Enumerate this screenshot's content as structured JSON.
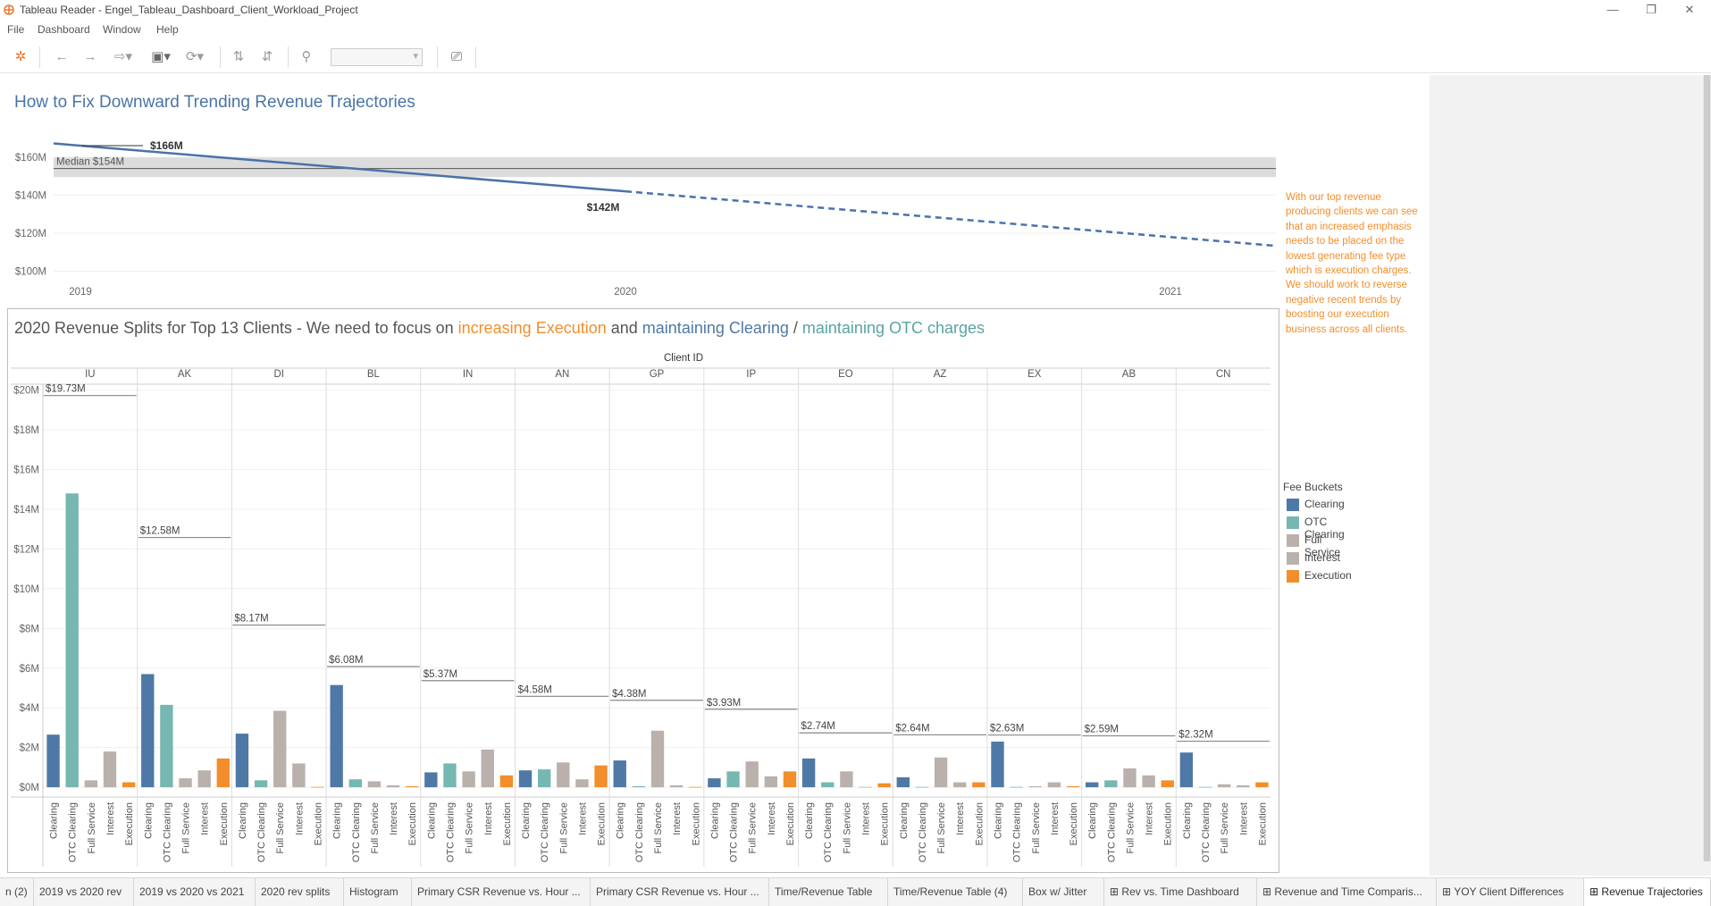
{
  "window": {
    "title": "Tableau Reader - Engel_Tableau_Dashboard_Client_Workload_Project",
    "minimize": "—",
    "restore": "❐",
    "close": "✕"
  },
  "menu": [
    "File",
    "Dashboard",
    "Window",
    "Help"
  ],
  "dashboard": {
    "title": "How to Fix Downward Trending Revenue Trajectories",
    "note": "With our top revenue producing clients we can see that an increased emphasis needs to be placed on the lowest generating fee type which is execution charges. We should work to reverse negative recent trends by boosting our execution business across all clients.",
    "splits_title": {
      "prefix": "2020 Revenue Splits for Top 13 Clients - We need to focus on ",
      "orange": "increasing Execution",
      "and": " and ",
      "blue": "maintaining Clearing",
      "slash": " / ",
      "teal": "maintaining OTC charges"
    }
  },
  "legend": {
    "title": "Fee Buckets",
    "items": [
      {
        "label": "Clearing",
        "color": "#4e79a7"
      },
      {
        "label": "OTC Clearing",
        "color": "#76b7b2"
      },
      {
        "label": "Full Service",
        "color": "#bab0ac"
      },
      {
        "label": "Interest",
        "color": "#bab0ac"
      },
      {
        "label": "Execution",
        "color": "#f28e2b"
      }
    ]
  },
  "tabs": [
    {
      "label": "n (2)",
      "icon": ""
    },
    {
      "label": "2019 vs 2020 rev",
      "icon": ""
    },
    {
      "label": "2019 vs 2020 vs 2021",
      "icon": ""
    },
    {
      "label": "2020 rev splits",
      "icon": ""
    },
    {
      "label": "Histogram",
      "icon": ""
    },
    {
      "label": "Primary CSR Revenue vs. Hour ...",
      "icon": ""
    },
    {
      "label": "Primary CSR Revenue vs. Hour ...",
      "icon": ""
    },
    {
      "label": "Time/Revenue Table",
      "icon": ""
    },
    {
      "label": "Time/Revenue Table (4)",
      "icon": ""
    },
    {
      "label": "Box w/ Jitter",
      "icon": ""
    },
    {
      "label": "Rev vs. Time Dashboard",
      "icon": "⊞"
    },
    {
      "label": "Revenue and Time Comparis...",
      "icon": "⊞"
    },
    {
      "label": "YOY Client Differences",
      "icon": "⊞"
    },
    {
      "label": "Revenue Trajectories",
      "icon": "⊞"
    }
  ],
  "chart_data": [
    {
      "type": "line",
      "title": "",
      "x": [
        "2019",
        "2020",
        "2021"
      ],
      "series": [
        {
          "style": "solid",
          "points": [
            [
              "2019",
              166
            ],
            [
              "2020",
              142
            ]
          ]
        },
        {
          "style": "dashed",
          "points": [
            [
              "2020",
              142
            ],
            [
              "2021",
              118
            ]
          ]
        }
      ],
      "ylabel": "",
      "ytick_labels": [
        "$100M",
        "$120M",
        "$140M",
        "$160M"
      ],
      "ylim": [
        97,
        174
      ],
      "annotations": [
        "$166M",
        "$142M"
      ],
      "reference_line": {
        "label": "Median $154M",
        "value": 154,
        "band": [
          149.5,
          160
        ]
      },
      "grid": true
    },
    {
      "type": "bar",
      "title": "2020 Revenue Splits for Top 13 Clients",
      "group_header": "Client ID",
      "categories": [
        "Clearing",
        "OTC Clearing",
        "Full Service",
        "Interest",
        "Execution"
      ],
      "colors": [
        "#4e79a7",
        "#76b7b2",
        "#bab0ac",
        "#bab0ac",
        "#f28e2b"
      ],
      "ytick_labels": [
        "$0M",
        "$2M",
        "$4M",
        "$6M",
        "$8M",
        "$10M",
        "$12M",
        "$14M",
        "$16M",
        "$18M",
        "$20M"
      ],
      "ylim": [
        -0.4,
        20.3
      ],
      "clients": [
        {
          "id": "IU",
          "total_label": "$19.73M",
          "total": 19.73,
          "values": [
            2.65,
            14.8,
            0.35,
            1.8,
            0.25
          ]
        },
        {
          "id": "AK",
          "total_label": "$12.58M",
          "total": 12.58,
          "values": [
            5.7,
            4.15,
            0.45,
            0.85,
            1.45
          ]
        },
        {
          "id": "DI",
          "total_label": "$8.17M",
          "total": 8.17,
          "values": [
            2.7,
            0.35,
            3.85,
            1.2,
            0.02
          ]
        },
        {
          "id": "BL",
          "total_label": "$6.08M",
          "total": 6.08,
          "values": [
            5.15,
            0.4,
            0.3,
            0.1,
            0.05
          ]
        },
        {
          "id": "IN",
          "total_label": "$5.37M",
          "total": 5.37,
          "values": [
            0.75,
            1.2,
            0.8,
            1.9,
            0.6
          ]
        },
        {
          "id": "AN",
          "total_label": "$4.58M",
          "total": 4.58,
          "values": [
            0.85,
            0.9,
            1.25,
            0.4,
            1.1
          ]
        },
        {
          "id": "GP",
          "total_label": "$4.38M",
          "total": 4.38,
          "values": [
            1.35,
            0.05,
            2.85,
            0.1,
            0.02
          ]
        },
        {
          "id": "IP",
          "total_label": "$3.93M",
          "total": 3.93,
          "values": [
            0.45,
            0.8,
            1.3,
            0.55,
            0.8
          ]
        },
        {
          "id": "EO",
          "total_label": "$2.74M",
          "total": 2.74,
          "values": [
            1.45,
            0.25,
            0.8,
            0.02,
            0.2
          ]
        },
        {
          "id": "AZ",
          "total_label": "$2.64M",
          "total": 2.64,
          "values": [
            0.5,
            0.02,
            1.5,
            0.25,
            0.25
          ]
        },
        {
          "id": "EX",
          "total_label": "$2.63M",
          "total": 2.63,
          "values": [
            2.3,
            0.02,
            0.05,
            0.25,
            0.05
          ]
        },
        {
          "id": "AB",
          "total_label": "$2.59M",
          "total": 2.59,
          "values": [
            0.25,
            0.35,
            0.95,
            0.6,
            0.35
          ]
        },
        {
          "id": "CN",
          "total_label": "$2.32M",
          "total": 2.32,
          "values": [
            1.75,
            0.02,
            0.15,
            0.1,
            0.25
          ]
        }
      ]
    }
  ]
}
